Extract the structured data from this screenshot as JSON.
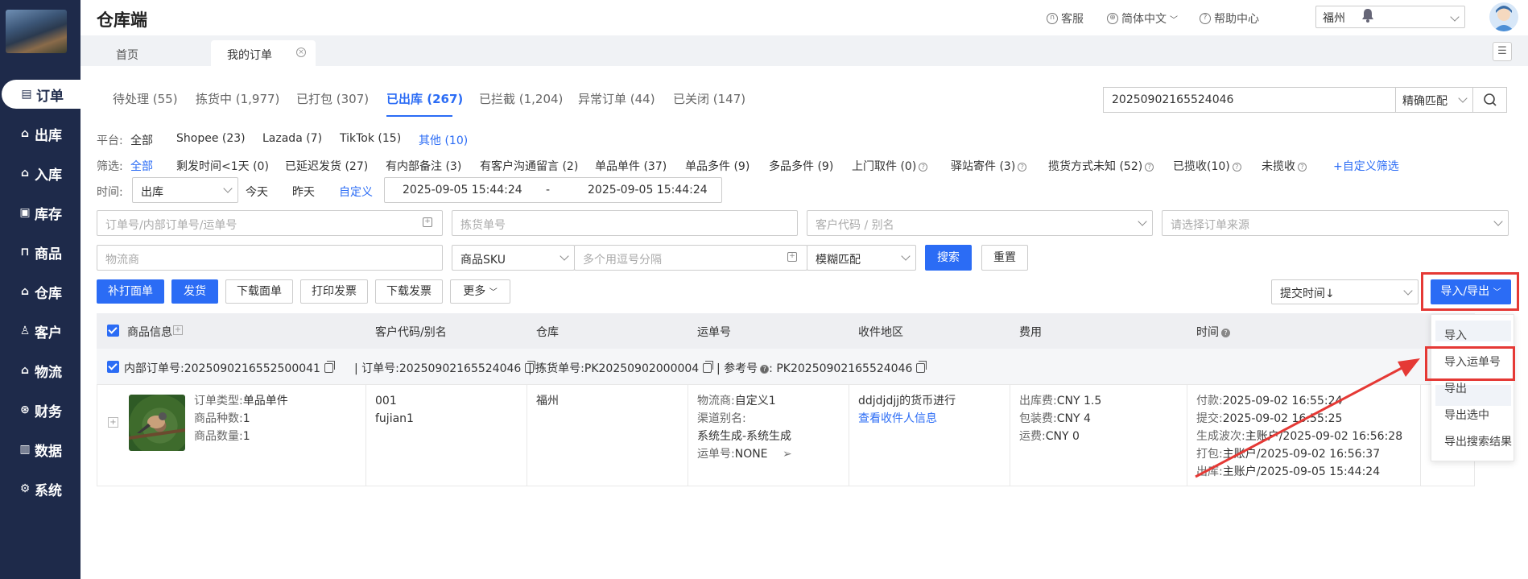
{
  "app": {
    "title": "仓库端"
  },
  "topbar": {
    "support": "客服",
    "language": "简体中文",
    "help": "帮助中心",
    "warehouse": "福州"
  },
  "nav": [
    {
      "label": "订单",
      "icon": "document-icon",
      "glyph": "▤",
      "active": true
    },
    {
      "label": "出库",
      "icon": "home-out-icon",
      "glyph": "⌂",
      "active": false
    },
    {
      "label": "入库",
      "icon": "home-in-icon",
      "glyph": "⌂",
      "active": false
    },
    {
      "label": "库存",
      "icon": "inventory-icon",
      "glyph": "▣",
      "active": false
    },
    {
      "label": "商品",
      "icon": "bag-icon",
      "glyph": "⊓",
      "active": false
    },
    {
      "label": "仓库",
      "icon": "warehouse-icon",
      "glyph": "⌂",
      "active": false
    },
    {
      "label": "客户",
      "icon": "user-icon",
      "glyph": "♙",
      "active": false
    },
    {
      "label": "物流",
      "icon": "truck-icon",
      "glyph": "⌂",
      "active": false
    },
    {
      "label": "财务",
      "icon": "finance-icon",
      "glyph": "⊛",
      "active": false
    },
    {
      "label": "数据",
      "icon": "chart-icon",
      "glyph": "▥",
      "active": false
    },
    {
      "label": "系统",
      "icon": "gear-icon",
      "glyph": "⚙",
      "active": false
    }
  ],
  "page_tabs": [
    {
      "label": "首页"
    },
    {
      "label": "我的订单"
    }
  ],
  "status_tabs": [
    {
      "label": "待处理 (55)"
    },
    {
      "label": "拣货中 (1,977)"
    },
    {
      "label": "已打包 (307)"
    },
    {
      "label": "已出库 (267)"
    },
    {
      "label": "已拦截 (1,204)"
    },
    {
      "label": "异常订单 (44)"
    },
    {
      "label": "已关闭 (147)"
    }
  ],
  "search": {
    "value": "20250902165524046",
    "match_mode": "精确匹配"
  },
  "platform": {
    "label": "平台:",
    "options": [
      "全部",
      "Shopee (23)",
      "Lazada (7)",
      "TikTok (15)",
      "其他 (10)"
    ]
  },
  "filter": {
    "label": "筛选:",
    "options": [
      "全部",
      "剩发时间<1天 (0)",
      "已延迟发货 (27)",
      "有内部备注 (3)",
      "有客户沟通留言 (2)",
      "单品单件 (37)",
      "单品多件 (9)",
      "多品多件 (9)",
      "上门取件 (0)",
      "驿站寄件 (3)",
      "揽货方式未知 (52)",
      "已揽收(10)",
      "未揽收"
    ],
    "custom": "+自定义筛选"
  },
  "time": {
    "label": "时间:",
    "type": "出库",
    "today": "今天",
    "yesterday": "昨天",
    "custom": "自定义",
    "start": "2025-09-05 15:44:24",
    "separator": "-",
    "end": "2025-09-05 15:44:24"
  },
  "form": {
    "order_no_placeholder": "订单号/内部订单号/运单号",
    "pick_no_placeholder": "拣货单号",
    "customer_placeholder": "客户代码 / 别名",
    "source_placeholder": "请选择订单来源",
    "carrier_placeholder": "物流商",
    "sku_type": "商品SKU",
    "multi_placeholder": "多个用逗号分隔",
    "fuzzy": "模糊匹配",
    "search_btn": "搜索",
    "reset_btn": "重置"
  },
  "actions": {
    "reprint": "补打面单",
    "ship": "发货",
    "download_label": "下载面单",
    "print_invoice": "打印发票",
    "download_invoice": "下载发票",
    "more": "更多",
    "sort": "提交时间↓",
    "import_export": "导入/导出"
  },
  "dropdown": [
    "导入",
    "导入运单号",
    "导出",
    "导出选中",
    "导出搜索结果"
  ],
  "table": {
    "headers": [
      "商品信息",
      "客户代码/别名",
      "仓库",
      "运单号",
      "收件地区",
      "费用",
      "时间"
    ]
  },
  "order": {
    "internal_no_label": "内部订单号:",
    "internal_no": "20250902165525000 41",
    "order_no_label": "订单号:",
    "order_no": "20250902165524046",
    "pick_no_label": "拣货单号:",
    "pick_no": "PK20250902000004",
    "ref_label": "参考号",
    "ref_no": "PK20250902165524046",
    "product": [
      {
        "label": "订单类型:",
        "value": "单品单件"
      },
      {
        "label": "商品种数:",
        "value": "1"
      },
      {
        "label": "商品数量:",
        "value": "1"
      }
    ],
    "customer_code": "001",
    "customer_alias": "fujian1",
    "warehouse": "福州",
    "carrier_label": "物流商:",
    "carrier": "自定义1",
    "channel_label": "渠道别名:",
    "channel": "系统生成-系统生成",
    "waybill_label": "运单号:",
    "waybill": "NONE",
    "region": "ddjdjdjj的货币进行",
    "view_recipient": "查看收件人信息",
    "fees": [
      {
        "label": "出库费:",
        "value": "CNY 1.5"
      },
      {
        "label": "包装费:",
        "value": "CNY 4"
      },
      {
        "label": "运费:",
        "value": "CNY 0"
      }
    ],
    "times": [
      {
        "label": "付款:",
        "value": "2025-09-02 16:55:24"
      },
      {
        "label": "提交:",
        "value": "2025-09-02 16:55:25"
      },
      {
        "label": "生成波次:",
        "value": "主账户/2025-09-02 16:56:28"
      },
      {
        "label": "打包:",
        "value": "主账户/2025-09-02 16:56:37"
      },
      {
        "label": "出库:",
        "value": "主账户/2025-09-05 15:44:24"
      }
    ]
  },
  "colors": {
    "accent": "#2b6cf5",
    "sidebar": "#1e2a4a",
    "highlight": "#e53935"
  }
}
